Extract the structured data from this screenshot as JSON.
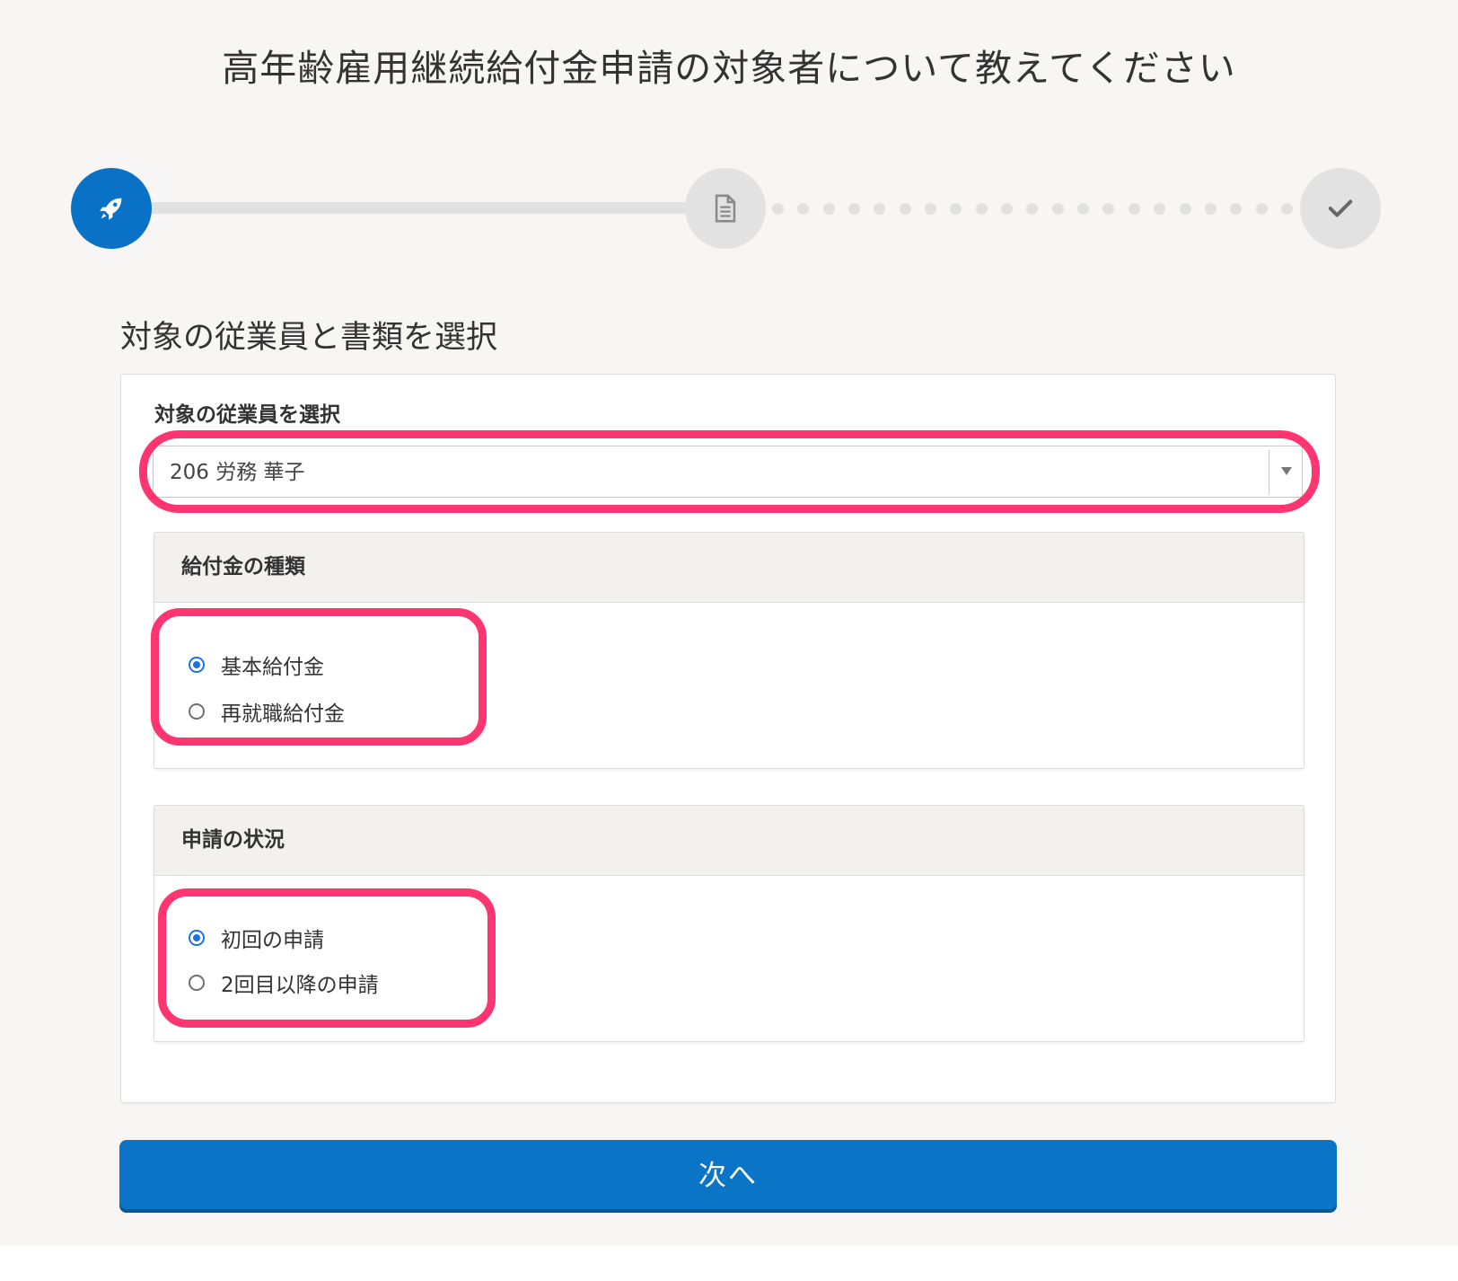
{
  "page": {
    "title": "高年齢雇用継続給付金申請の対象者について教えてください"
  },
  "stepper": {
    "steps": [
      {
        "icon": "rocket-icon",
        "state": "active"
      },
      {
        "icon": "document-icon",
        "state": "pending"
      },
      {
        "icon": "checkmark-icon",
        "state": "pending"
      }
    ],
    "accent_color": "#0a72c6",
    "inactive_color": "#e2e2e2"
  },
  "section": {
    "heading": "対象の従業員と書類を選択"
  },
  "employee": {
    "label": "対象の従業員を選択",
    "selected": "206 労務 華子"
  },
  "benefit_type": {
    "title": "給付金の種類",
    "options": [
      {
        "label": "基本給付金",
        "checked": true
      },
      {
        "label": "再就職給付金",
        "checked": false
      }
    ]
  },
  "application_status": {
    "title": "申請の状況",
    "options": [
      {
        "label": "初回の申請",
        "checked": true
      },
      {
        "label": "2回目以降の申請",
        "checked": false
      }
    ]
  },
  "actions": {
    "next_label": "次へ"
  },
  "highlight_color": "#ff3571"
}
